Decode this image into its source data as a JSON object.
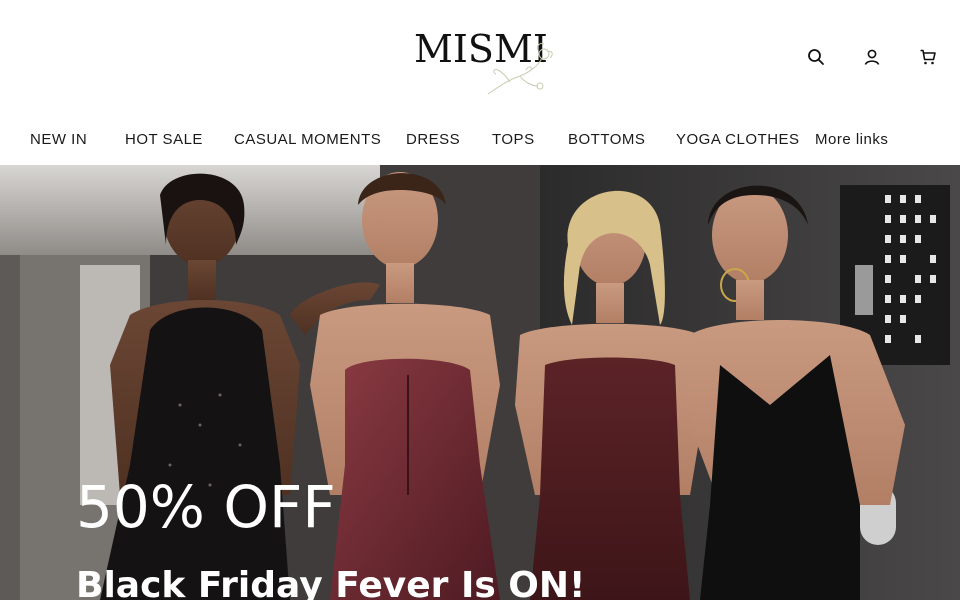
{
  "brand": {
    "name": "MISMI"
  },
  "header": {
    "icons": [
      {
        "name": "search-icon"
      },
      {
        "name": "account-icon"
      },
      {
        "name": "cart-icon"
      }
    ]
  },
  "nav": {
    "items": [
      {
        "label": "NEW IN"
      },
      {
        "label": "HOT SALE"
      },
      {
        "label": "CASUAL MOMENTS"
      },
      {
        "label": "DRESS"
      },
      {
        "label": "TOPS"
      },
      {
        "label": "BOTTOMS"
      },
      {
        "label": "YOGA CLOTHES"
      },
      {
        "label": "More links"
      }
    ]
  },
  "hero": {
    "headline": "50% OFF",
    "subheadline": "Black Friday Fever Is ON!"
  },
  "colors": {
    "text": "#1a1a1a",
    "hero_text": "#ffffff",
    "background": "#ffffff"
  }
}
